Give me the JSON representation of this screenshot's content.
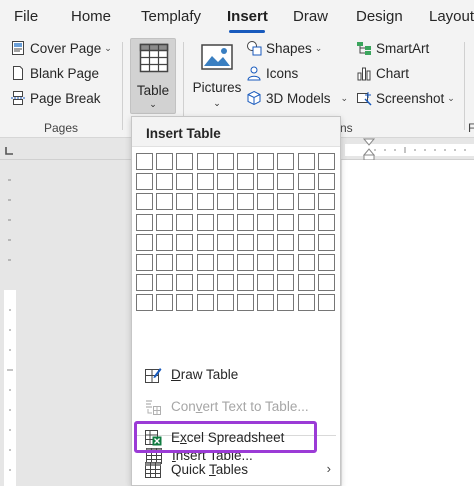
{
  "tabs": [
    {
      "label": "File",
      "active": false
    },
    {
      "label": "Home",
      "active": false
    },
    {
      "label": "Templafy",
      "active": false
    },
    {
      "label": "Insert",
      "active": true
    },
    {
      "label": "Draw",
      "active": false
    },
    {
      "label": "Design",
      "active": false
    },
    {
      "label": "Layout",
      "active": false
    }
  ],
  "ribbon": {
    "pages_group": {
      "label": "Pages",
      "items": [
        {
          "label": "Cover Page",
          "icon": "cover-page-icon",
          "has_dropdown": true
        },
        {
          "label": "Blank Page",
          "icon": "blank-page-icon"
        },
        {
          "label": "Page Break",
          "icon": "page-break-icon"
        }
      ]
    },
    "table_button": {
      "label": "Table",
      "icon": "table-icon"
    },
    "illustrations": {
      "pictures_label": "Pictures",
      "shapes_label": "Shapes",
      "icons_label": "Icons",
      "models_label": "3D Models",
      "group_label_fragment": "ns"
    },
    "addins": {
      "smartart_label": "SmartArt",
      "chart_label": "Chart",
      "screenshot_label": "Screenshot",
      "group_label_fragment": "F"
    }
  },
  "dropdown": {
    "title": "Insert Table",
    "grid": {
      "columns": 10,
      "rows": 8
    },
    "items": [
      {
        "label": "Insert Table...",
        "mnemonic": "I",
        "icon": "insert-table-icon",
        "enabled": true
      },
      {
        "label": "Draw Table",
        "mnemonic": "D",
        "icon": "draw-table-icon",
        "enabled": true
      },
      {
        "label": "Convert Text to Table...",
        "mnemonic": "v",
        "icon": "convert-text-icon",
        "enabled": false
      },
      {
        "label": "Excel Spreadsheet",
        "mnemonic": "x",
        "icon": "excel-spreadsheet-icon",
        "enabled": true,
        "highlighted": true
      },
      {
        "label": "Quick Tables",
        "mnemonic": "T",
        "icon": "quick-tables-icon",
        "enabled": true,
        "has_submenu": true
      }
    ]
  },
  "colors": {
    "accent": "#185abd",
    "highlight": "#9b3bd6",
    "excel_green": "#107c41"
  }
}
